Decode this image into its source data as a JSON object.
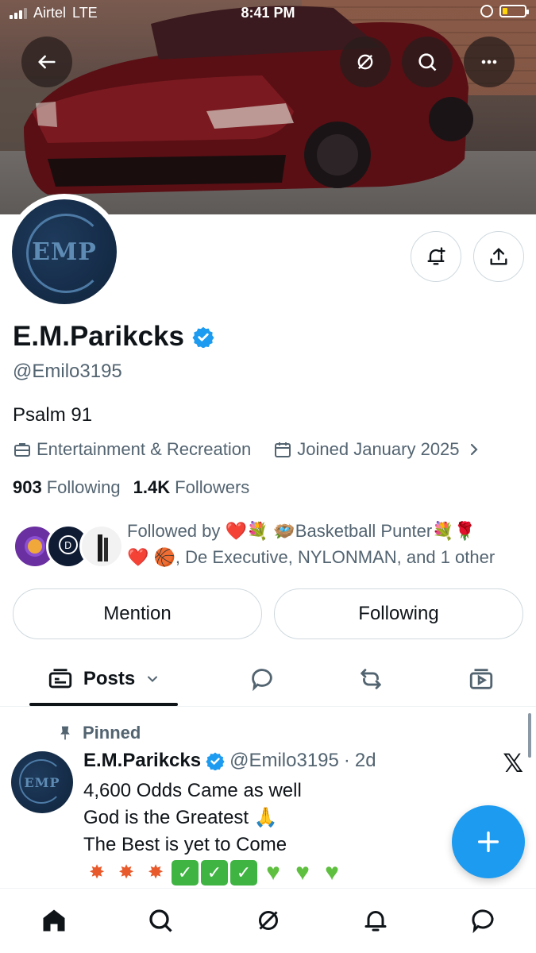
{
  "status_bar": {
    "carrier": "Airtel",
    "network": "LTE",
    "time": "8:41 PM"
  },
  "profile": {
    "name": "E.M.Parikcks",
    "handle": "@Emilo3195",
    "avatar_text": "EMP",
    "bio": "Psalm 91",
    "category": "Entertainment & Recreation",
    "joined": "Joined January 2025",
    "following_count": "903",
    "following_label": "Following",
    "followers_count": "1.4K",
    "followers_label": "Followers",
    "followed_by_line1": "Followed by ❤️💐 🪺Basketball Punter💐🌹",
    "followed_by_line2": "❤️ 🏀, De Executive, NYLONMAN, and 1 other"
  },
  "actions": {
    "mention_label": "Mention",
    "following_label": "Following"
  },
  "tabs": {
    "posts_label": "Posts"
  },
  "pinned_post": {
    "pinned_label": "Pinned",
    "author_name": "E.M.Parikcks",
    "author_handle": "@Emilo3195",
    "separator": "·",
    "time_ago": "2d",
    "line1": "4,600 Odds Came as well",
    "line2": "God is the Greatest 🙏",
    "line3": "The Best is yet to Come",
    "x_logo": "𝕏"
  },
  "colors": {
    "accent": "#1d9bf0",
    "verified": "#1d9bf0",
    "text_secondary": "#536471",
    "border": "#cfd9de"
  },
  "icons": [
    "back-arrow-icon",
    "grok-icon",
    "search-icon",
    "more-icon",
    "notify-bell-icon",
    "share-icon",
    "briefcase-icon",
    "calendar-icon",
    "chevron-right-icon",
    "pin-icon",
    "reply-icon",
    "repost-icon",
    "media-icon",
    "plus-icon",
    "home-icon",
    "bell-icon",
    "message-icon"
  ]
}
